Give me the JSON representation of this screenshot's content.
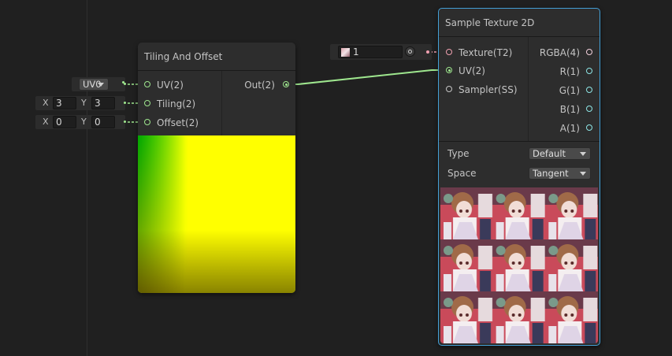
{
  "tiling_node": {
    "title": "Tiling And Offset",
    "inputs": [
      "UV(2)",
      "Tiling(2)",
      "Offset(2)"
    ],
    "output": "Out(2)",
    "uv_channel": "UV0",
    "tiling": {
      "x_label": "X",
      "x": "3",
      "y_label": "Y",
      "y": "3"
    },
    "offset": {
      "x_label": "X",
      "x": "0",
      "y_label": "Y",
      "y": "0"
    }
  },
  "texture_field": {
    "value": "1"
  },
  "sample_node": {
    "title": "Sample Texture 2D",
    "inputs": [
      "Texture(T2)",
      "UV(2)",
      "Sampler(SS)"
    ],
    "outputs": [
      "RGBA(4)",
      "R(1)",
      "G(1)",
      "B(1)",
      "A(1)"
    ],
    "type_label": "Type",
    "type_value": "Default",
    "space_label": "Space",
    "space_value": "Tangent"
  },
  "colors": {
    "background": "#202020",
    "node_body": "#2d2d2d",
    "selection": "#44a0d8",
    "vector2_port": "#9ee68e",
    "float_port": "#8ee6e6",
    "texture_port": "#f0a0b0"
  }
}
